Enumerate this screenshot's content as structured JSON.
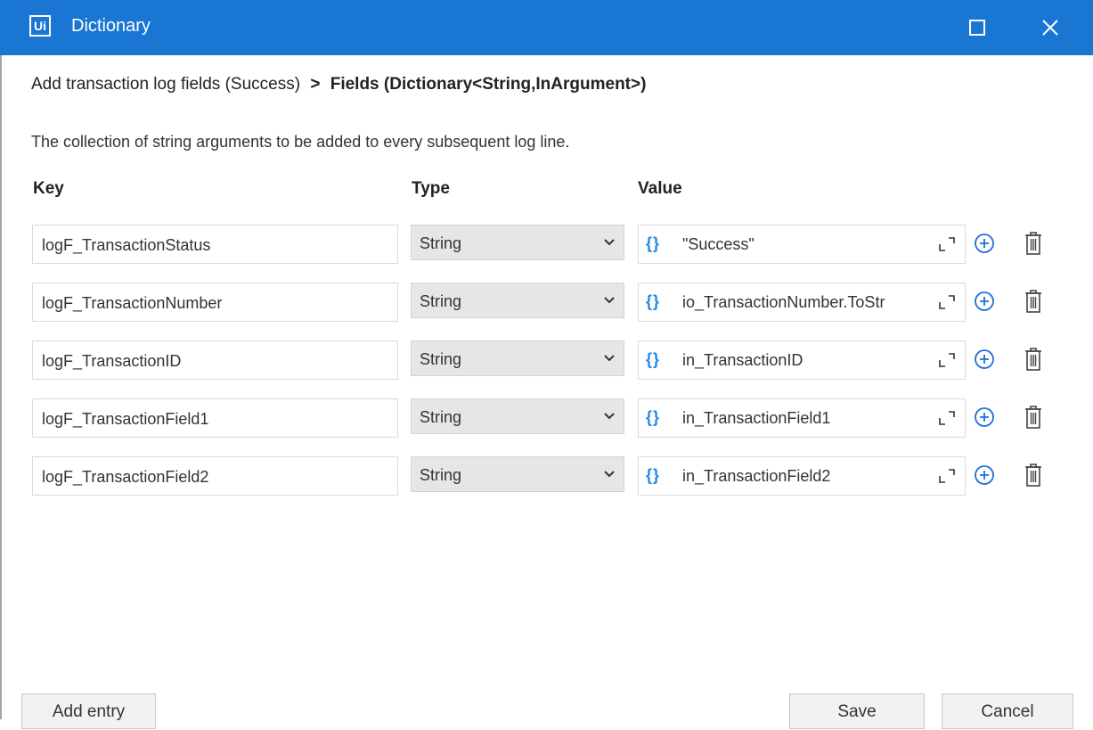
{
  "window": {
    "logo": "Ui",
    "title": "Dictionary",
    "maximize_icon": "maximize-icon",
    "close_icon": "close-icon",
    "accent": "#1976d2"
  },
  "breadcrumb": {
    "parent": "Add transaction log fields (Success)",
    "separator": ">",
    "current": "Fields (Dictionary<String,InArgument>)"
  },
  "description": "The collection of string arguments to be added to every subsequent log line.",
  "columns": {
    "key": "Key",
    "type": "Type",
    "value": "Value"
  },
  "rows": [
    {
      "key": "logF_TransactionStatus",
      "type": "String",
      "value": "\"Success\""
    },
    {
      "key": "logF_TransactionNumber",
      "type": "String",
      "value": "io_TransactionNumber.ToStr"
    },
    {
      "key": "logF_TransactionID",
      "type": "String",
      "value": "in_TransactionID"
    },
    {
      "key": "logF_TransactionField1",
      "type": "String",
      "value": "in_TransactionField1"
    },
    {
      "key": "logF_TransactionField2",
      "type": "String",
      "value": "in_TransactionField2"
    }
  ],
  "value_prefix": "{}",
  "footer": {
    "add_entry": "Add entry",
    "save": "Save",
    "cancel": "Cancel"
  }
}
